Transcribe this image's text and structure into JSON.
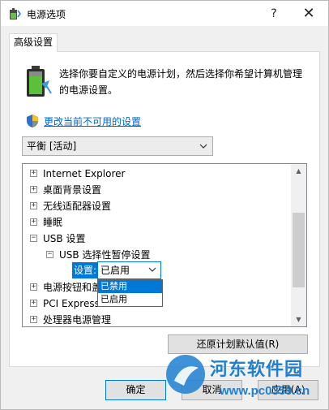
{
  "window": {
    "title": "电源选项",
    "help_glyph": "?",
    "close_glyph": "✕"
  },
  "tab": {
    "label": "高级设置"
  },
  "description": {
    "line1": "选择你要自定义的电源计划，然后选择你希望计算机管理",
    "line2": "的电源设置。"
  },
  "change_link": "更改当前不可用的设置",
  "plan_select": {
    "value": "平衡 [活动]"
  },
  "tree": {
    "items": [
      {
        "expander": "+",
        "label": "Internet Explorer"
      },
      {
        "expander": "+",
        "label": "桌面背景设置"
      },
      {
        "expander": "+",
        "label": "无线适配器设置"
      },
      {
        "expander": "+",
        "label": "睡眠"
      },
      {
        "expander": "−",
        "label": "USB 设置"
      },
      {
        "expander": "−",
        "label": "USB 选择性暂停设置"
      },
      {
        "expander": "",
        "label": ""
      },
      {
        "expander": "+",
        "label": "电源按钮和盖"
      },
      {
        "expander": "+",
        "label": "PCI Express"
      },
      {
        "expander": "+",
        "label": "处理器电源管理"
      }
    ],
    "setting_label": "设置:",
    "setting_value": "已启用",
    "options": [
      "已禁用",
      "已启用"
    ]
  },
  "buttons": {
    "restore": "还原计划默认值(R)",
    "ok": "确定",
    "cancel": "取消",
    "apply": "应用(A)"
  },
  "watermark": {
    "name": "河东软件园",
    "url": "www.pc0359.cn"
  },
  "colors": {
    "accent": "#0078d7",
    "link": "#0066cc",
    "watermark": "#1f7fd1"
  }
}
